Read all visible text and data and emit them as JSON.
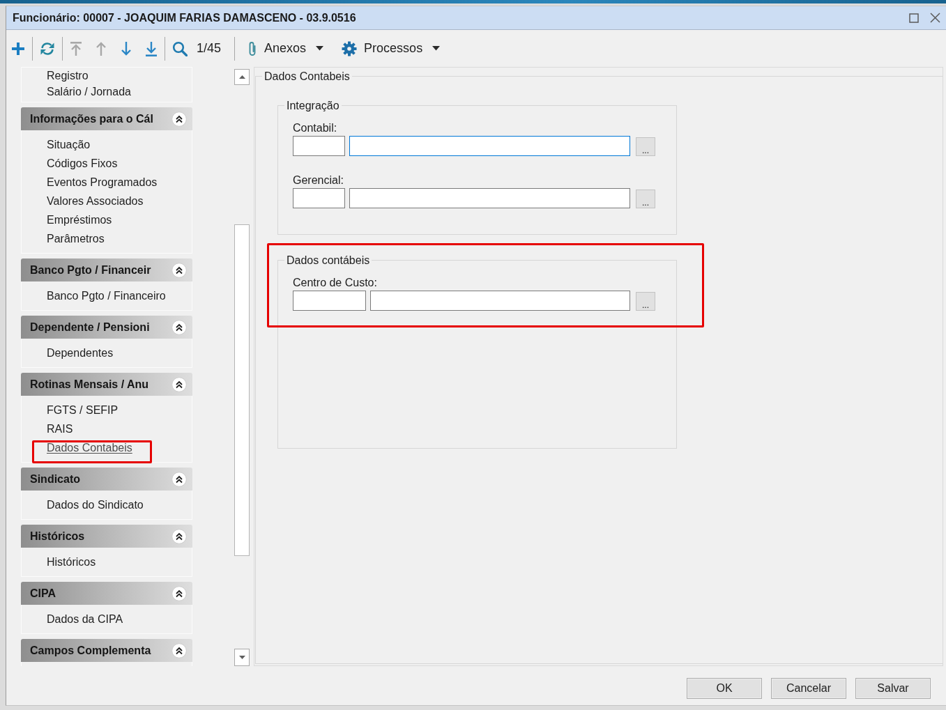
{
  "window": {
    "title": "Funcionário: 00007 - JOAQUIM FARIAS DAMASCENO - 03.9.0516"
  },
  "toolbar": {
    "groups": [
      [
        {
          "kind": "add",
          "disabled": false
        }
      ],
      [
        {
          "kind": "refresh",
          "disabled": false
        }
      ],
      [
        {
          "kind": "first",
          "disabled": true
        },
        {
          "kind": "previous",
          "disabled": true
        },
        {
          "kind": "next",
          "disabled": false
        },
        {
          "kind": "last",
          "disabled": false
        }
      ],
      [
        {
          "kind": "search",
          "disabled": false
        },
        {
          "kind": "counter",
          "label": "1/45"
        }
      ]
    ],
    "menus": [
      {
        "kind": "attachments",
        "label": "Anexos"
      },
      {
        "kind": "processes",
        "label": "Processos"
      }
    ]
  },
  "sidebar": {
    "sections": [
      {
        "items": [
          {
            "label": "Registro",
            "selected": false,
            "highlighted": false
          },
          {
            "label": "Salário / Jornada",
            "selected": false,
            "highlighted": false
          }
        ]
      },
      {
        "title": "Informações para o Cál",
        "expanded": true,
        "items": [
          {
            "label": "Situação",
            "selected": false,
            "highlighted": false
          },
          {
            "label": "Códigos Fixos",
            "selected": false,
            "highlighted": false
          },
          {
            "label": "Eventos Programados",
            "selected": false,
            "highlighted": false
          },
          {
            "label": "Valores Associados",
            "selected": false,
            "highlighted": false
          },
          {
            "label": "Empréstimos",
            "selected": false,
            "highlighted": false
          },
          {
            "label": "Parâmetros",
            "selected": false,
            "highlighted": false
          }
        ]
      },
      {
        "title": "Banco Pgto / Financeir",
        "expanded": true,
        "items": [
          {
            "label": "Banco Pgto / Financeiro",
            "selected": false,
            "highlighted": false
          }
        ]
      },
      {
        "title": "Dependente / Pensioni",
        "expanded": true,
        "items": [
          {
            "label": "Dependentes",
            "selected": false,
            "highlighted": false
          }
        ]
      },
      {
        "title": "Rotinas Mensais / Anu",
        "expanded": true,
        "items": [
          {
            "label": "FGTS / SEFIP",
            "selected": false,
            "highlighted": false
          },
          {
            "label": "RAIS",
            "selected": false,
            "highlighted": false
          },
          {
            "label": "Dados Contabeis",
            "selected": true,
            "highlighted": true
          }
        ]
      },
      {
        "title": "Sindicato",
        "expanded": true,
        "items": [
          {
            "label": "Dados do Sindicato",
            "selected": false,
            "highlighted": false
          }
        ]
      },
      {
        "title": "Históricos",
        "expanded": true,
        "items": [
          {
            "label": "Históricos",
            "selected": false,
            "highlighted": false
          }
        ]
      },
      {
        "title": "CIPA",
        "expanded": true,
        "items": [
          {
            "label": "Dados da CIPA",
            "selected": false,
            "highlighted": false
          }
        ]
      },
      {
        "title": "Campos Complementa",
        "expanded": true
      }
    ]
  },
  "form": {
    "title": "Dados Contabeis",
    "groups": [
      {
        "title": "Integração",
        "highlighted": false,
        "fields": [
          {
            "label": "Contabil:",
            "inputs": [
              {
                "focused": false
              },
              {
                "focused": true
              }
            ],
            "button": "..."
          },
          {
            "label": "Gerencial:",
            "inputs": [
              {
                "focused": false
              },
              {
                "focused": false
              }
            ],
            "button": "..."
          }
        ]
      },
      {
        "title": "Dados contábeis",
        "highlighted": true,
        "fields": [
          {
            "label": "Centro de Custo:",
            "inputs": [
              {
                "focused": false
              },
              {
                "focused": false
              }
            ],
            "button": "..."
          }
        ]
      }
    ]
  },
  "buttons": [
    "OK",
    "Cancelar",
    "Salvar"
  ]
}
